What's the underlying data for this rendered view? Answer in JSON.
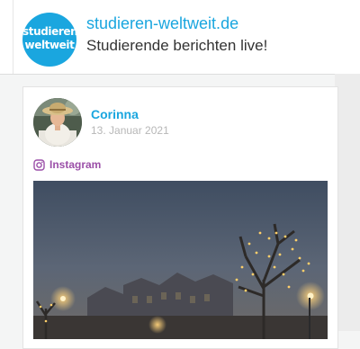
{
  "header": {
    "logo": {
      "line1": "studieren",
      "line2": "weltweit",
      "color": "#1aa6df"
    },
    "title": "studieren-weltweit.de",
    "tagline": "Studierende berichten live!"
  },
  "post": {
    "author": "Corinna",
    "date": "13. Januar 2021",
    "source": {
      "icon": "instagram-icon",
      "label": "Instagram",
      "color": "#9b4fa8"
    }
  },
  "colors": {
    "accent": "#1aa6df",
    "muted": "#b7b7b7",
    "text": "#333333"
  }
}
